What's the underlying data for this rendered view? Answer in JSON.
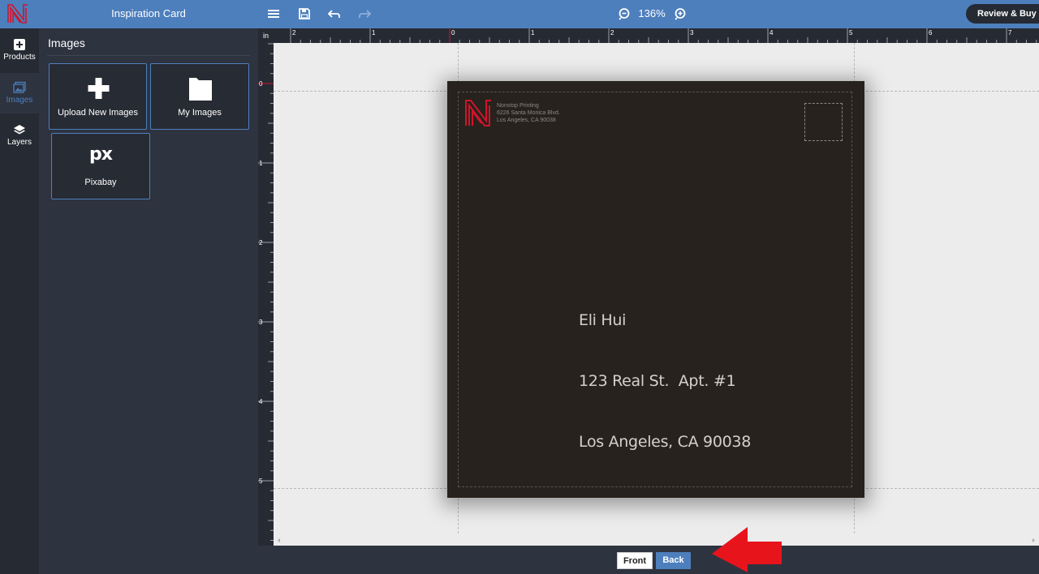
{
  "header": {
    "title": "Inspiration Card",
    "zoom": "136%",
    "review_buy": "Review & Buy"
  },
  "rail": {
    "items": [
      {
        "label": "Products",
        "icon": "add-box-icon"
      },
      {
        "label": "Images",
        "icon": "images-icon",
        "active": true
      },
      {
        "label": "Layers",
        "icon": "layers-icon"
      }
    ]
  },
  "panel": {
    "title": "Images",
    "tiles": [
      {
        "label": "Upload New Images",
        "icon": "plus-icon"
      },
      {
        "label": "My Images",
        "icon": "folder-icon"
      },
      {
        "label": "Pixabay",
        "icon": "pixabay-icon",
        "icon_text": "px"
      }
    ]
  },
  "ruler": {
    "unit": "in",
    "top_labels": [
      "2",
      "1",
      "0",
      "1",
      "2",
      "3",
      "4",
      "5",
      "6",
      "7"
    ],
    "left_labels": [
      "0",
      "1",
      "2",
      "3",
      "4",
      "5"
    ]
  },
  "card": {
    "return_address": [
      "Nonstop Printing",
      "6226 Santa Monica Blvd.",
      "Los Angeles, CA 90038"
    ],
    "mail_address": [
      "Eli Hui",
      "123 Real St.  Apt. #1",
      "Los Angeles, CA 90038"
    ]
  },
  "sides": {
    "front": "Front",
    "back": "Back",
    "active": "Back"
  },
  "colors": {
    "accent": "#4d7fbd",
    "dark": "#2e3340",
    "card_bg": "#27221d",
    "logo_red": "#d0142b",
    "annotation_red": "#e8141c"
  }
}
